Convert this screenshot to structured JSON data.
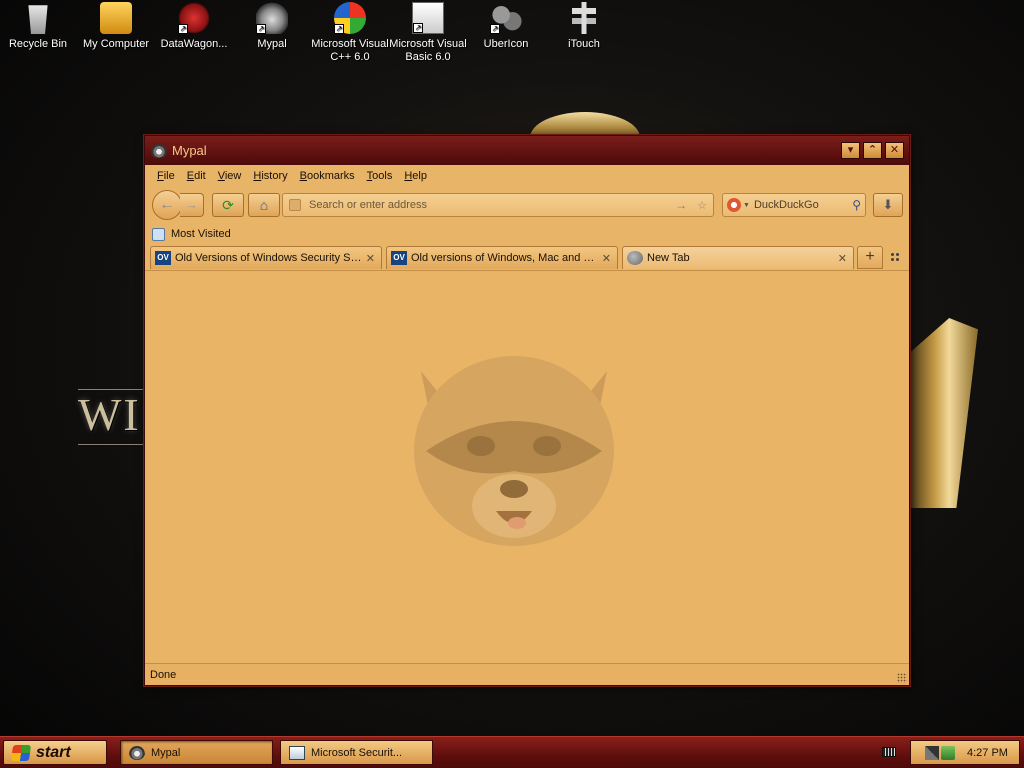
{
  "desktop": {
    "icons": [
      {
        "label": "Recycle Bin",
        "icon": "recycle-bin-icon"
      },
      {
        "label": "My Computer",
        "icon": "my-computer-icon"
      },
      {
        "label": "DataWagon...",
        "icon": "datawagon-icon"
      },
      {
        "label": "Mypal",
        "icon": "mypal-icon"
      },
      {
        "label": "Microsoft Visual C++ 6.0",
        "icon": "visual-cpp-icon"
      },
      {
        "label": "Microsoft Visual Basic 6.0",
        "icon": "visual-basic-icon"
      },
      {
        "label": "UberIcon",
        "icon": "ubericon-icon"
      },
      {
        "label": "iTouch",
        "icon": "itouch-icon"
      }
    ],
    "wallpaper_text": "WI"
  },
  "window": {
    "title": "Mypal",
    "caption_buttons": {
      "minimize": "▾",
      "maximize": "⌃",
      "close": "✕"
    }
  },
  "menu": {
    "items": [
      {
        "accel": "F",
        "rest": "ile"
      },
      {
        "accel": "E",
        "rest": "dit"
      },
      {
        "accel": "V",
        "rest": "iew"
      },
      {
        "accel": "H",
        "rest": "istory"
      },
      {
        "accel": "B",
        "rest": "ookmarks"
      },
      {
        "accel": "T",
        "rest": "ools"
      },
      {
        "accel": "H",
        "rest": "elp"
      }
    ]
  },
  "navbar": {
    "back": "←",
    "forward": "→",
    "reload": "⟳",
    "home": "⌂",
    "url_placeholder": "Search or enter address",
    "go": "→",
    "bookmark_star": "☆",
    "search_engine": "DuckDuckGo",
    "search_go": "⚲",
    "download": "⬇"
  },
  "bookmarks": {
    "most_visited": "Most Visited"
  },
  "tabs": [
    {
      "favicon": "OV",
      "title": "Old Versions of Windows Security Soft...",
      "close": "✕",
      "active": false
    },
    {
      "favicon": "OV",
      "title": "Old versions of Windows, Mac and Lin...",
      "close": "✕",
      "active": false
    },
    {
      "favicon": "",
      "title": "New Tab",
      "close": "✕",
      "active": true
    }
  ],
  "tabstrip": {
    "new_tab": "+"
  },
  "statusbar": {
    "text": "Done"
  },
  "taskbar": {
    "start_label": "start",
    "tasks": [
      {
        "label": "Mypal",
        "active": true
      },
      {
        "label": "Microsoft Securit...",
        "active": false
      }
    ],
    "clock": "4:27 PM"
  },
  "colors": {
    "window_title_bar": "#5a0f0e",
    "content_background": "#e9b466",
    "taskbar": "#5e0f0d",
    "accent_gold": "#d9994a"
  }
}
